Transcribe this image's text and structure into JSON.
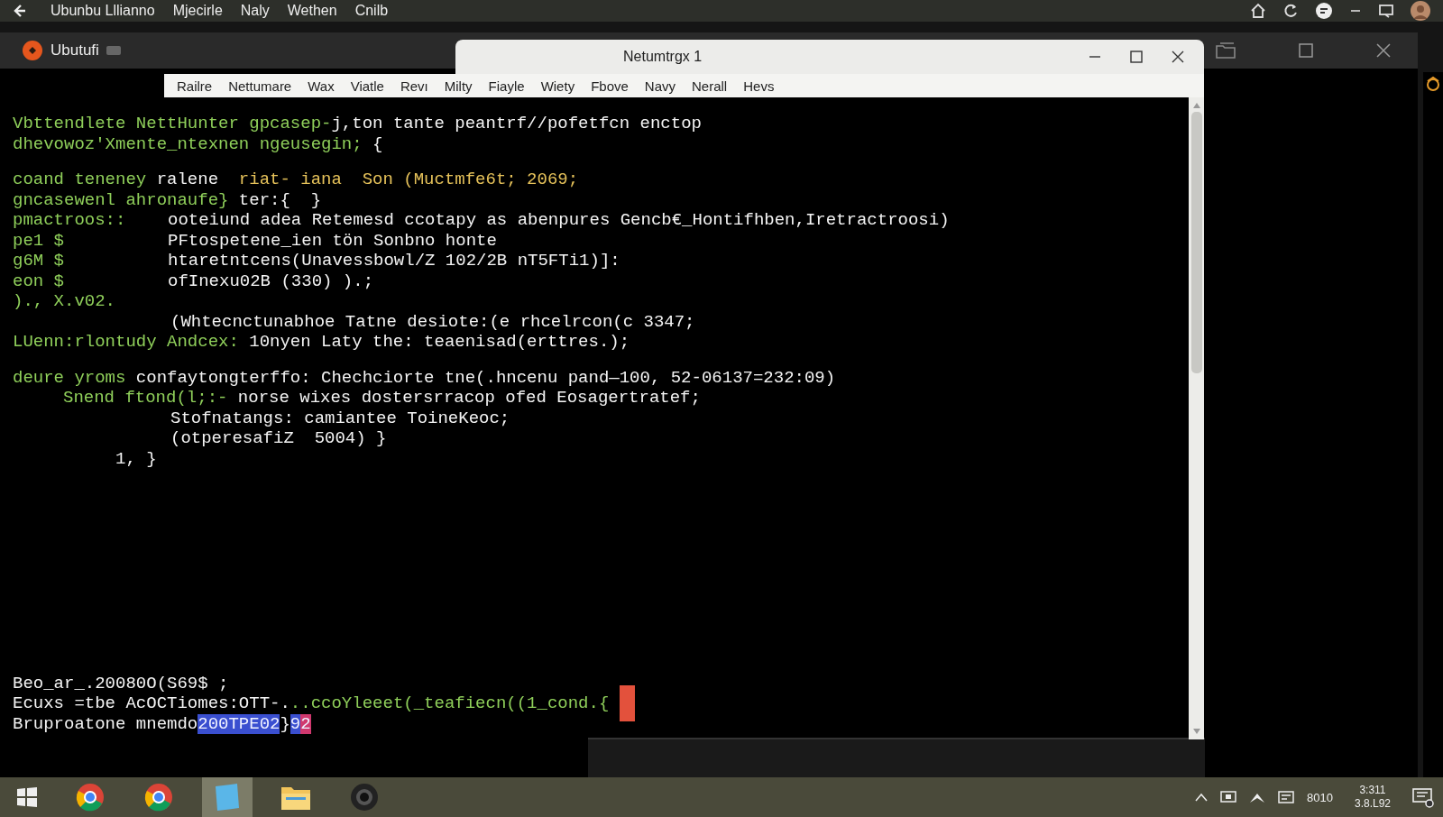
{
  "top_bar": {
    "menu": [
      "Ubunbu Lllianno",
      "Mjecirle",
      "Naly",
      "Wethen",
      "Cnilb"
    ]
  },
  "outer_window": {
    "tab_title": "Ubutufi"
  },
  "terminal_window": {
    "title": "Netumtrgx 1",
    "menu": [
      "Railre",
      "Nettumare",
      "Wax",
      "Viatle",
      "Revı",
      "Milty",
      "Fiayle",
      "Wiety",
      "Fbove",
      "Navy",
      "Nerall",
      "Hevs"
    ],
    "blocks": [
      {
        "lines": [
          {
            "kind": "plain",
            "segments": [
              {
                "color": "#8fcf5a",
                "text": "Vbttendlete NettHunter gpcasep-"
              },
              {
                "color": "#f4f4f4",
                "text": "j,ton tante peantrf//pofetfcn enctop"
              }
            ]
          },
          {
            "kind": "plain",
            "segments": [
              {
                "color": "#8fcf5a",
                "text": "dhevowoz'Xmente_ntexnen ngeusegin;"
              },
              {
                "color": "#f4f4f4",
                "text": " {"
              }
            ]
          }
        ]
      },
      {
        "lines": [
          {
            "kind": "plain",
            "segments": [
              {
                "color": "#8fcf5a",
                "text": "coand teneney "
              },
              {
                "color": "#f4f4f4",
                "text": "ralene  "
              },
              {
                "color": "#e6c25a",
                "text": "riat- iana  Son (Muctmfe6t; 2069;"
              }
            ]
          },
          {
            "kind": "plain",
            "segments": [
              {
                "color": "#8fcf5a",
                "text": "gncasewenl ahronaufe}"
              },
              {
                "color": "#f4f4f4",
                "text": " ter:{  }"
              }
            ]
          },
          {
            "kind": "split",
            "segments": [
              {
                "color": "#8fcf5a",
                "text": "pmactroos::"
              },
              {
                "color": "#f4f4f4",
                "text": "ooteiund adea Retemesd ccotapy as abenpures Gencb€_Hontifhben,Iretractroosi)"
              }
            ]
          },
          {
            "kind": "split",
            "segments": [
              {
                "color": "#8fcf5a",
                "text": "pe1 $"
              },
              {
                "color": "#f4f4f4",
                "text": "PFtospetene_ien tön Sonbno honte"
              }
            ]
          },
          {
            "kind": "split",
            "segments": [
              {
                "color": "#8fcf5a",
                "text": "g6M $"
              },
              {
                "color": "#f4f4f4",
                "text": "htaretntcens(Unavessbowl/Z 102/2B nT5FTi1)]:"
              }
            ]
          },
          {
            "kind": "split",
            "segments": [
              {
                "color": "#8fcf5a",
                "text": "eon $"
              },
              {
                "color": "#f4f4f4",
                "text": "ofInexu02B (330) ).;"
              }
            ]
          },
          {
            "kind": "plain",
            "segments": [
              {
                "color": "#8fcf5a",
                "text": ")., X.v02."
              }
            ]
          },
          {
            "kind": "indent",
            "segments": [
              {
                "color": "#f4f4f4",
                "text": "(Whtecnctunabhoe Tatne desiote:(e rhcelrcon(c 3347;"
              }
            ]
          },
          {
            "kind": "plain",
            "segments": [
              {
                "color": "#8fcf5a",
                "text": "LUenn:rlontudy Andcex:"
              },
              {
                "color": "#f4f4f4",
                "text": " 10nyen Laty the: teaenisad(erttres.);"
              }
            ]
          }
        ]
      },
      {
        "lines": [
          {
            "kind": "plain",
            "segments": [
              {
                "color": "#8fcf5a",
                "text": "deure yroms"
              },
              {
                "color": "#f4f4f4",
                "text": " confaytongterffo: Chechciorte tne(.hncenu pand—100, 52-06137=232:09)"
              }
            ]
          },
          {
            "kind": "nested",
            "segments": [
              {
                "color": "#8fcf5a",
                "text": "Snend ftond(l;:-"
              },
              {
                "color": "#f4f4f4",
                "text": " norse wixes dostersrracop ofed Eosagertratef;"
              }
            ]
          },
          {
            "kind": "indent",
            "segments": [
              {
                "color": "#f4f4f4",
                "text": "Stofnatangs: camiantee ToineKeoc;"
              }
            ]
          },
          {
            "kind": "indent",
            "segments": [
              {
                "color": "#f4f4f4",
                "text": "(otperesafiZ  5004) }"
              }
            ]
          },
          {
            "kind": "short",
            "segments": [
              {
                "color": "#f4f4f4",
                "text": "1, }"
              }
            ]
          }
        ]
      },
      {
        "lines": [
          {
            "kind": "plain",
            "segments": [
              {
                "color": "#f4f4f4",
                "text": "Beo_ar_.20080O(S69$ ;"
              }
            ]
          },
          {
            "kind": "cursor",
            "segments": [
              {
                "color": "#f4f4f4",
                "text": "Ecuxs =tbe AcOCTiomes:OTT-."
              },
              {
                "color": "#8fcf5a",
                "text": "..ccoYleeet(_teafiecn((1_cond.{"
              }
            ]
          },
          {
            "kind": "plain",
            "segments": [
              {
                "color": "#f4f4f4",
                "text": "Bruproatone mnemdo"
              },
              {
                "kind": "selection",
                "color": "#3a4fd0",
                "text": "200TPE02"
              },
              {
                "text": "}"
              },
              {
                "kind": "selection",
                "color": "#3a4fd0",
                "text": "9"
              },
              {
                "kind": "selection",
                "color": "#d0386e",
                "text": "2"
              }
            ]
          }
        ]
      }
    ]
  },
  "taskbar": {
    "apps": [
      {
        "kind": "chrome",
        "selected": false
      },
      {
        "kind": "chrome",
        "selected": false
      },
      {
        "kind": "notes",
        "selected": true
      },
      {
        "kind": "folder",
        "selected": false
      },
      {
        "kind": "camera",
        "selected": false
      }
    ],
    "tray_label": "8010",
    "time": "3:311",
    "date": "3.8.L92"
  }
}
